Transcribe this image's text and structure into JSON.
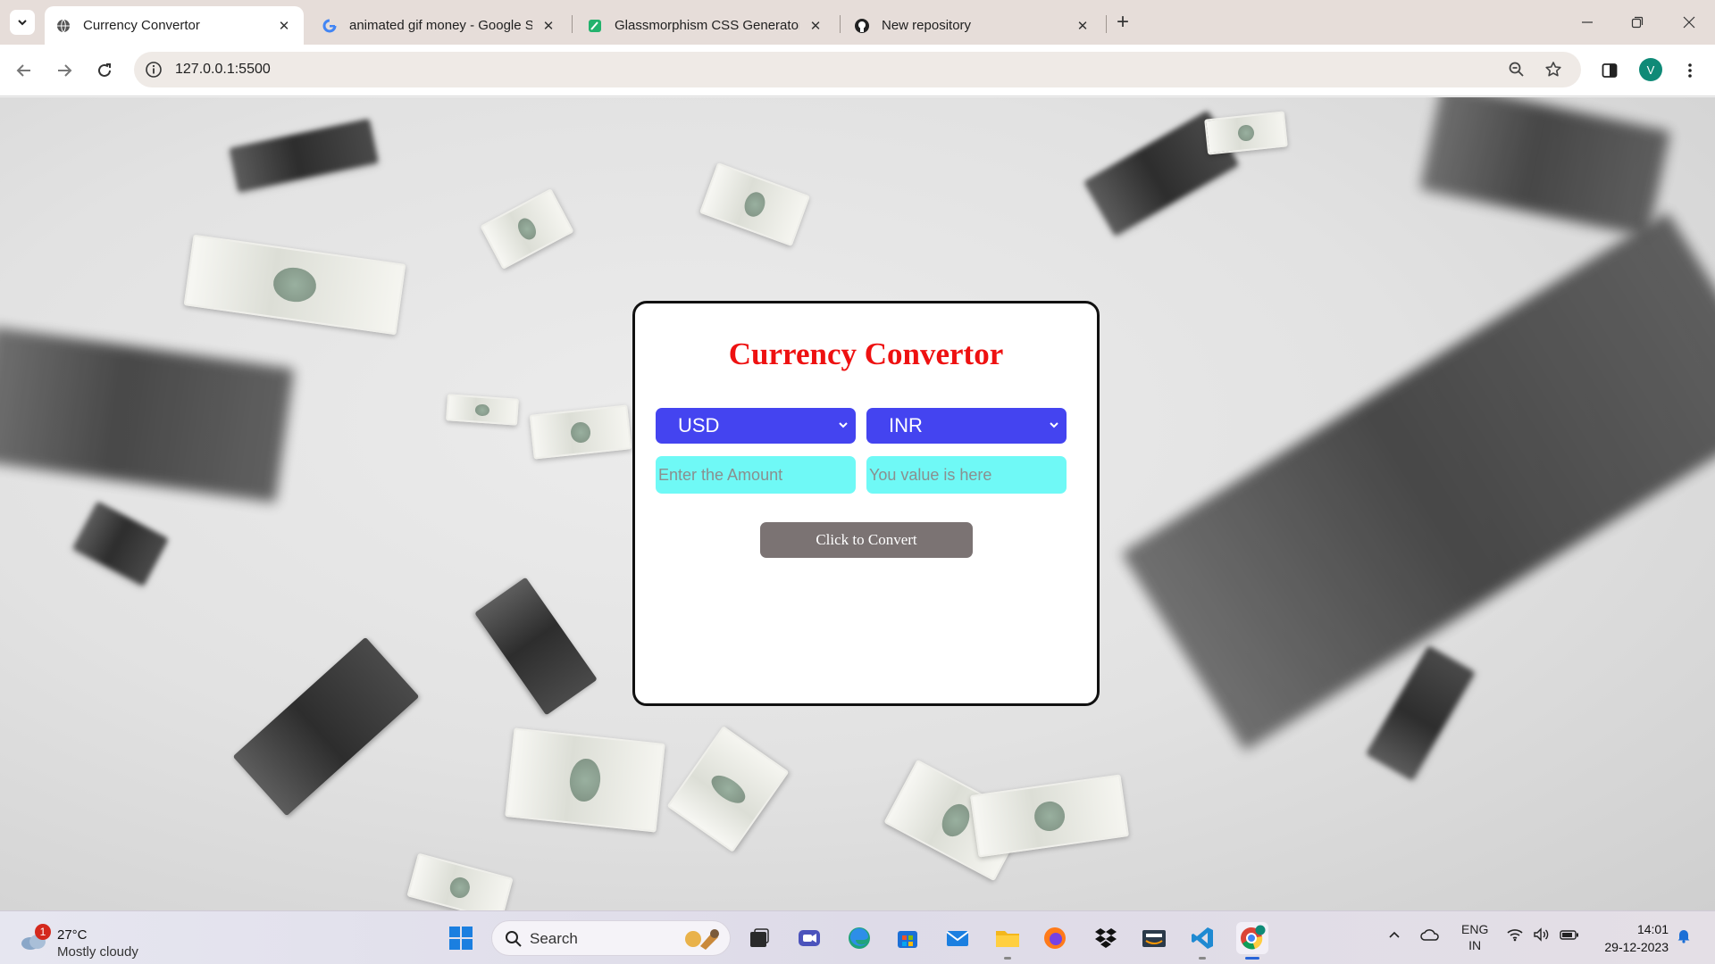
{
  "browser": {
    "tabs": [
      {
        "title": "Currency Convertor",
        "favicon": "globe-icon",
        "active": true
      },
      {
        "title": "animated gif money - Google S",
        "favicon": "google-icon",
        "active": false
      },
      {
        "title": "Glassmorphism CSS Generator -",
        "favicon": "glass-icon",
        "active": false
      },
      {
        "title": "New repository",
        "favicon": "github-icon",
        "active": false
      }
    ],
    "url": "127.0.0.1:5500",
    "profile_initial": "V"
  },
  "page": {
    "title": "Currency Convertor",
    "from_currency": "USD",
    "to_currency": "INR",
    "amount_placeholder": "Enter the Amount",
    "result_placeholder": "You value is here",
    "convert_label": "Click to Convert",
    "colors": {
      "title": "#ee1111",
      "select_bg": "#4444f0",
      "field_bg": "#6ff9f6",
      "button_bg": "#7b7373"
    }
  },
  "taskbar": {
    "weather_badge": "1",
    "temperature": "27°C",
    "condition": "Mostly cloudy",
    "search_label": "Search",
    "lang_line1": "ENG",
    "lang_line2": "IN",
    "time": "14:01",
    "date": "29-12-2023"
  }
}
